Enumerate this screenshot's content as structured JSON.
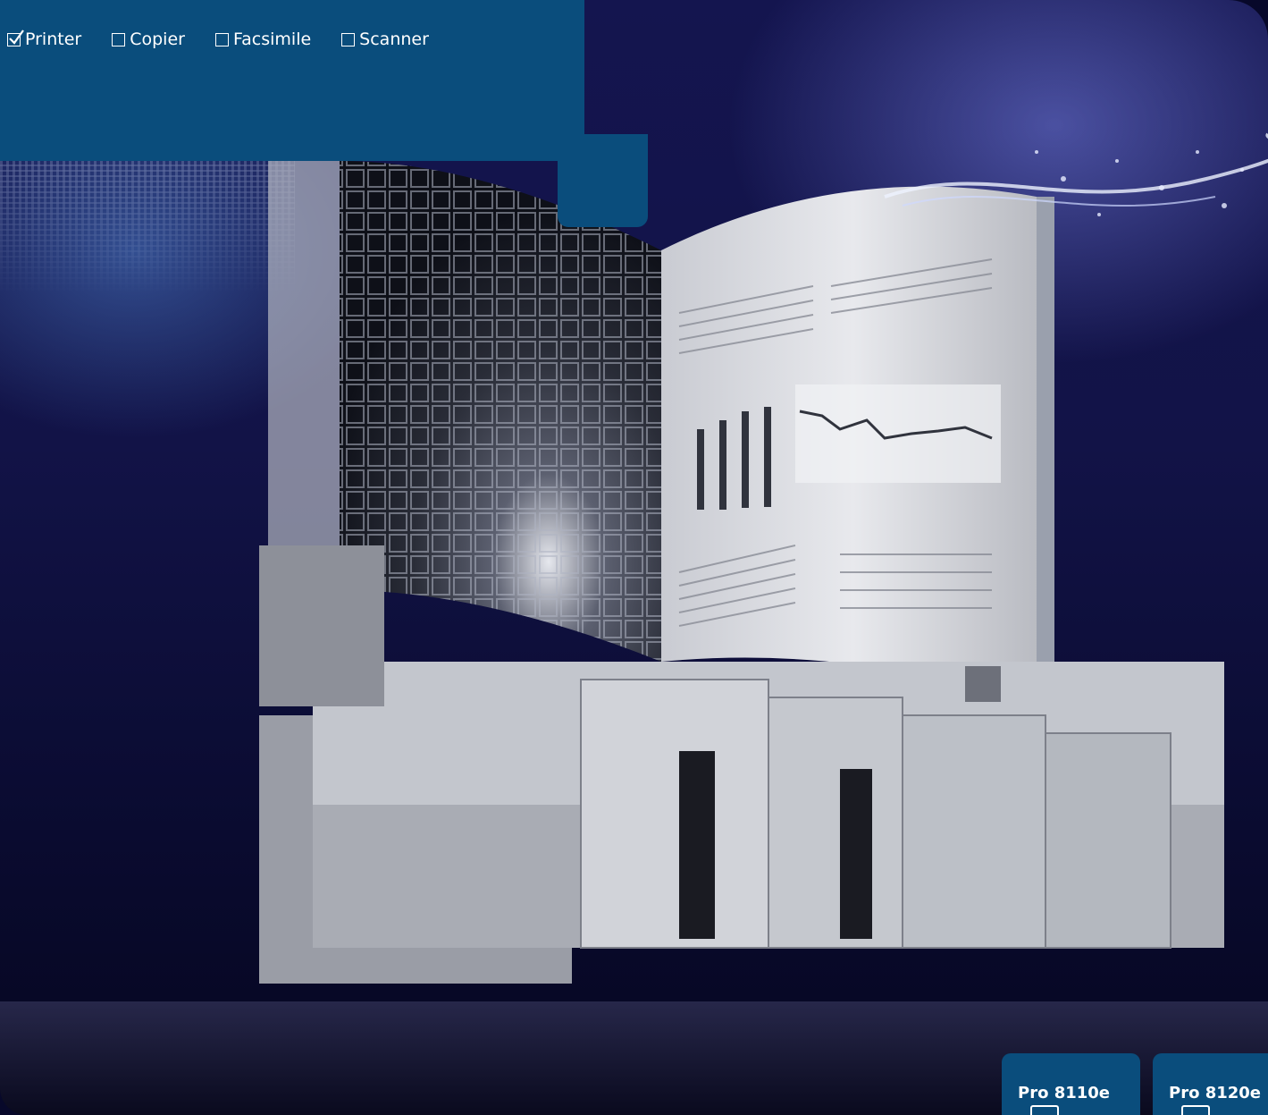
{
  "categories": [
    {
      "label": "Printer",
      "checked": true
    },
    {
      "label": "Copier",
      "checked": false
    },
    {
      "label": "Facsimile",
      "checked": false
    },
    {
      "label": "Scanner",
      "checked": false
    }
  ],
  "models": [
    {
      "label": "Pro 8110e"
    },
    {
      "label": "Pro 8120e"
    }
  ],
  "colors": {
    "header": "#0a4d7c",
    "background": "#12134a",
    "text": "#ffffff"
  }
}
